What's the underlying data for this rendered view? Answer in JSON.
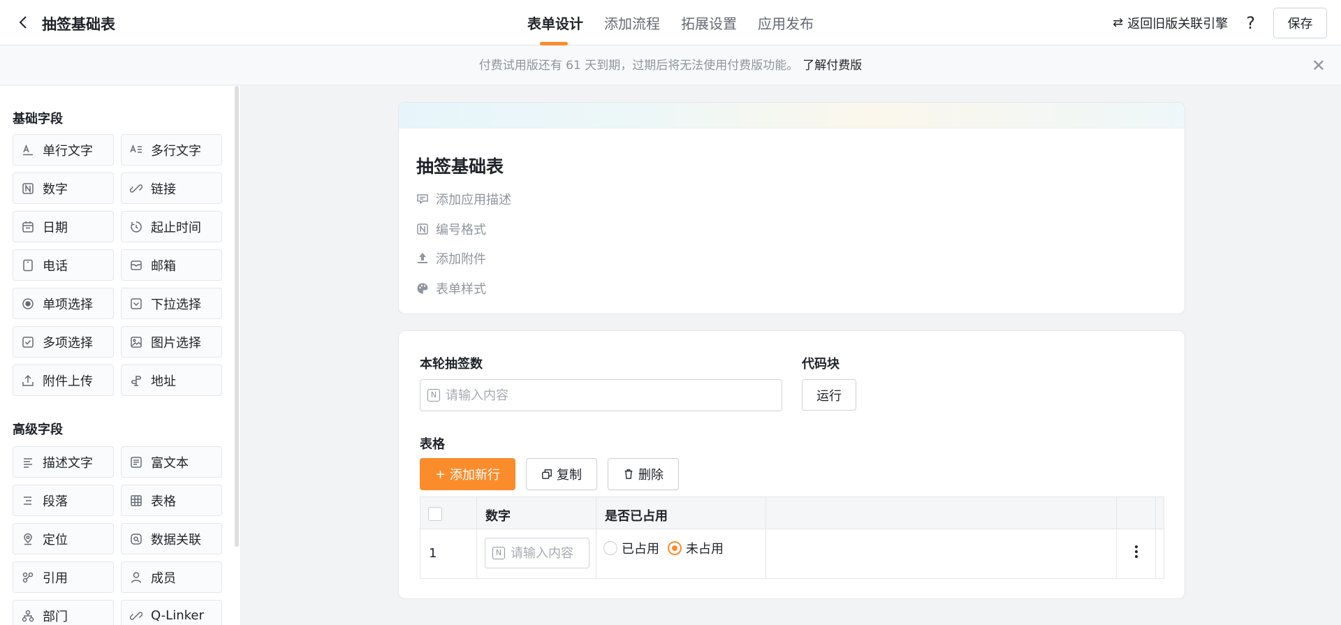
{
  "header": {
    "title": "抽签基础表",
    "tabs": [
      {
        "label": "表单设计",
        "active": true
      },
      {
        "label": "添加流程",
        "active": false
      },
      {
        "label": "拓展设置",
        "active": false
      },
      {
        "label": "应用发布",
        "active": false
      }
    ],
    "legacy_link": "返回旧版关联引擎",
    "help": "?",
    "save_label": "保存"
  },
  "banner": {
    "text": "付费试用版还有 61 天到期，过期后将无法使用付费版功能。",
    "link": "了解付费版"
  },
  "sidebar": {
    "basic_title": "基础字段",
    "basic_fields": [
      {
        "label": "单行文字",
        "icon": "single-line-text-icon"
      },
      {
        "label": "多行文字",
        "icon": "multi-line-text-icon"
      },
      {
        "label": "数字",
        "icon": "number-icon"
      },
      {
        "label": "链接",
        "icon": "link-icon"
      },
      {
        "label": "日期",
        "icon": "date-icon"
      },
      {
        "label": "起止时间",
        "icon": "time-range-icon"
      },
      {
        "label": "电话",
        "icon": "phone-icon"
      },
      {
        "label": "邮箱",
        "icon": "mail-icon"
      },
      {
        "label": "单项选择",
        "icon": "radio-icon"
      },
      {
        "label": "下拉选择",
        "icon": "dropdown-icon"
      },
      {
        "label": "多项选择",
        "icon": "checkbox-icon"
      },
      {
        "label": "图片选择",
        "icon": "image-icon"
      },
      {
        "label": "附件上传",
        "icon": "upload-icon"
      },
      {
        "label": "地址",
        "icon": "address-icon"
      }
    ],
    "advanced_title": "高级字段",
    "advanced_fields": [
      {
        "label": "描述文字",
        "icon": "description-icon"
      },
      {
        "label": "富文本",
        "icon": "rich-text-icon"
      },
      {
        "label": "段落",
        "icon": "paragraph-icon"
      },
      {
        "label": "表格",
        "icon": "table-icon"
      },
      {
        "label": "定位",
        "icon": "location-icon"
      },
      {
        "label": "数据关联",
        "icon": "data-link-icon"
      },
      {
        "label": "引用",
        "icon": "reference-icon"
      },
      {
        "label": "成员",
        "icon": "member-icon"
      },
      {
        "label": "部门",
        "icon": "department-icon"
      },
      {
        "label": "Q-Linker",
        "icon": "q-linker-icon"
      }
    ]
  },
  "form_header": {
    "title": "抽签基础表",
    "items": [
      {
        "label": "添加应用描述",
        "icon": "comment-icon"
      },
      {
        "label": "编号格式",
        "icon": "number-format-icon"
      },
      {
        "label": "添加附件",
        "icon": "upload-icon"
      },
      {
        "label": "表单样式",
        "icon": "palette-icon"
      }
    ]
  },
  "form": {
    "draw_count_label": "本轮抽签数",
    "draw_count_placeholder": "请输入内容",
    "code_block_label": "代码块",
    "run_label": "运行",
    "table_label": "表格",
    "add_row_label": "添加新行",
    "copy_label": "复制",
    "delete_label": "删除",
    "table": {
      "columns": [
        "数字",
        "是否已占用"
      ],
      "rows": [
        {
          "index": "1",
          "number_placeholder": "请输入内容",
          "options": [
            "已占用",
            "未占用"
          ],
          "selected": "未占用"
        }
      ]
    }
  },
  "colors": {
    "accent": "#fa8c2c"
  }
}
